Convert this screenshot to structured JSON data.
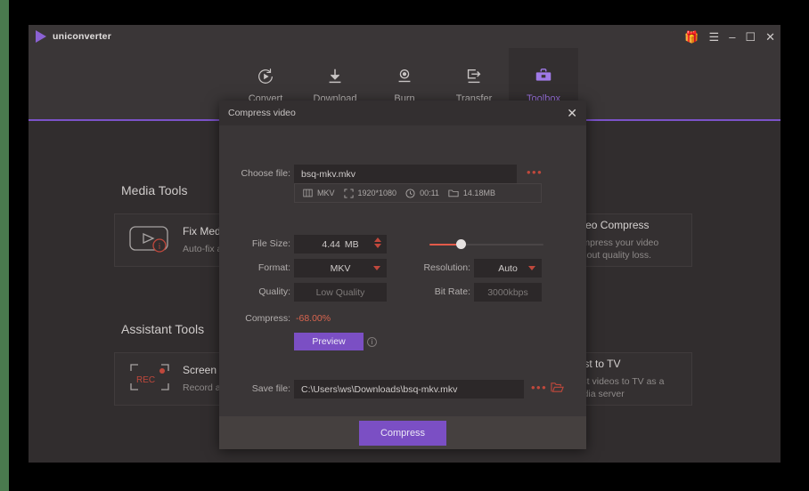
{
  "window": {
    "brand": "uniconverter",
    "controls": {
      "gift": "gift-icon",
      "menu": "☰",
      "minimize": "–",
      "maximize": "☐",
      "close": "✕"
    }
  },
  "nav": {
    "items": [
      {
        "label": "Convert",
        "icon": "convert-icon",
        "active": false
      },
      {
        "label": "Download",
        "icon": "download-icon",
        "active": false
      },
      {
        "label": "Burn",
        "icon": "burn-icon",
        "active": false
      },
      {
        "label": "Transfer",
        "icon": "transfer-icon",
        "active": false
      },
      {
        "label": "Toolbox",
        "icon": "toolbox-icon",
        "active": true
      }
    ]
  },
  "background": {
    "sections": [
      {
        "title": "Media Tools"
      },
      {
        "title": "Assistant Tools"
      }
    ],
    "cards": [
      {
        "title": "Fix Media",
        "desc": "Auto-fix and  media files",
        "icon": "fix-media-icon"
      },
      {
        "title": "Video Compress",
        "desc": "Compress your video without quality loss.",
        "icon": "video-compress-icon"
      },
      {
        "title": "Screen Re",
        "desc": "Record all de with audio si",
        "icon": "screen-recorder-icon"
      },
      {
        "title": "Cast to TV",
        "desc": "Cast videos to TV as a media server",
        "icon": "cast-to-tv-icon"
      }
    ]
  },
  "dialog": {
    "title": "Compress video",
    "close_label": "✕",
    "choose_file": {
      "label": "Choose file:",
      "value": "bsq-mkv.mkv",
      "browse": "•••"
    },
    "meta": [
      {
        "icon": "film-icon",
        "value": "MKV"
      },
      {
        "icon": "resolution-icon",
        "value": "1920*1080"
      },
      {
        "icon": "clock-icon",
        "value": "00:11"
      },
      {
        "icon": "folder-icon",
        "value": "14.18MB"
      }
    ],
    "file_size": {
      "label": "File Size:",
      "value": "4.44",
      "unit": "MB"
    },
    "format": {
      "label": "Format:",
      "value": "MKV"
    },
    "quality": {
      "label": "Quality:",
      "value": "Low Quality"
    },
    "resolution": {
      "label": "Resolution:",
      "value": "Auto"
    },
    "bit_rate": {
      "label": "Bit Rate:",
      "value": "3000kbps"
    },
    "slider": {
      "percent": 28
    },
    "compress": {
      "label": "Compress:",
      "value": "-68.00%"
    },
    "preview_button": "Preview",
    "info_icon": "i",
    "save_file": {
      "label": "Save file:",
      "value": "C:\\Users\\ws\\Downloads\\bsq-mkv.mkv",
      "browse": "•••",
      "folder_icon": "folder-open-icon"
    },
    "submit_button": "Compress"
  },
  "colors": {
    "accent_purple": "#7b4fc4",
    "accent_red": "#c0483c",
    "compress_text": "#d9654f",
    "window_bg": "#3a3637",
    "content_bg": "#312d2e"
  }
}
